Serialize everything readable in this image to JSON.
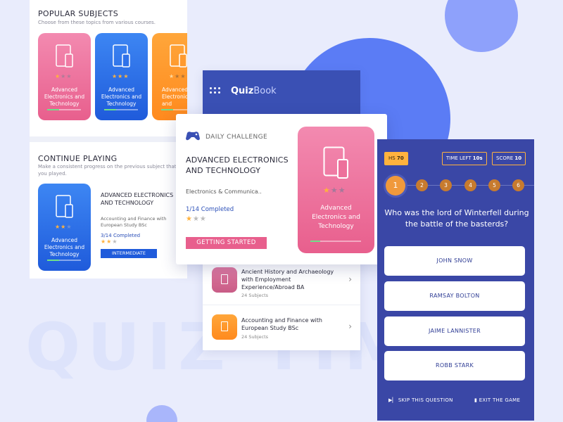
{
  "background": {
    "watermark": "QUIZ TIME"
  },
  "colors": {
    "primary": "#3a47a6",
    "pink": "#e96a94",
    "blue": "#2b6fe8",
    "orange": "#ff9a2e",
    "accent": "#ffb23e"
  },
  "popular": {
    "title": "POPULAR SUBJECTS",
    "subtitle": "Choose from these topics from various courses.",
    "cards": [
      {
        "label": "Advanced Electronics and Technology",
        "stars": 1,
        "icon": "tablet-phone-icon"
      },
      {
        "label": "Advanced Electronics and Technology",
        "stars": 3,
        "icon": "tablet-phone-icon"
      },
      {
        "label": "Advanced Electronics and",
        "stars": 1,
        "icon": "tablet-phone-icon"
      }
    ]
  },
  "continue": {
    "title": "CONTINUE PLAYING",
    "subtitle": "Make a consistent progress on the previous subject that you played.",
    "card_label": "Advanced Electronics and Technology",
    "card_stars": 2,
    "course_title": "ADVANCED ELECTRONICS AND TECHNOLOGY",
    "course_sub": "Accounting and Finance with European Study BSc",
    "completed": "3/14 Completed",
    "stars": 2,
    "level_button": "INTERMEDIATE"
  },
  "quizbook": {
    "logo_prefix": "Quiz",
    "logo_suffix": "Book",
    "items": [
      {
        "title": "Ancient History and Archaeology with Employment Experience/Abroad BA",
        "subtitle": "24 Subjects"
      },
      {
        "title": "Accounting and Finance with European Study BSc",
        "subtitle": "24 Subjects"
      }
    ]
  },
  "daily": {
    "label": "DAILY CHALLENGE",
    "title": "ADVANCED ELECTRONICS AND TECHNOLOGY",
    "subtitle": "Electronics & Communica..",
    "completed": "1/14 Completed",
    "stars": 1,
    "button": "GETTING STARTED",
    "card_label": "Advanced Electronics and Technology",
    "card_stars": 1,
    "progress": 0.2
  },
  "quiz": {
    "hs_label": "HS",
    "hs_value": "70",
    "time_label": "TIME LEFT",
    "time_value": "10s",
    "score_label": "SCORE",
    "score_value": "10",
    "steps": [
      "1",
      "2",
      "3",
      "4",
      "5",
      "6"
    ],
    "current_step": 1,
    "question": "Who was the lord of Winterfell during the battle of the basterds?",
    "answers": [
      "JOHN SNOW",
      "RAMSAY BOLTON",
      "JAIME LANNISTER",
      "ROBB STARK"
    ],
    "skip": "SKIP THIS QUESTION",
    "exit": "EXIT THE GAME"
  }
}
